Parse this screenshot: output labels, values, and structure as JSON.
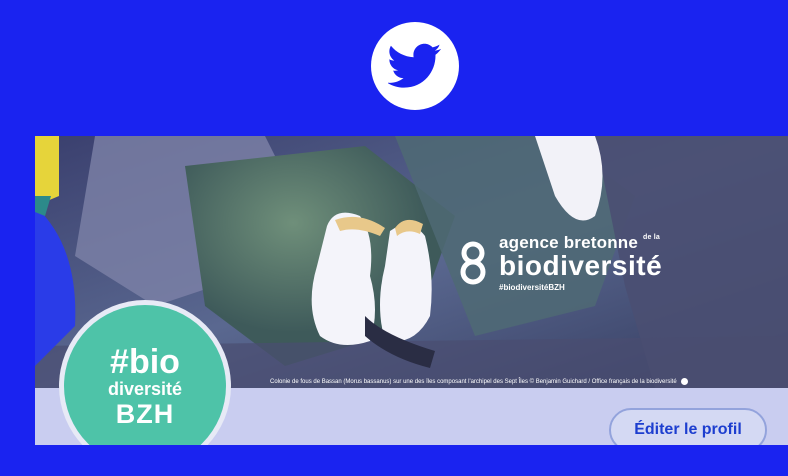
{
  "brand": {
    "icon": "twitter-bird-icon",
    "background": "#1a23f0"
  },
  "banner": {
    "logo_line1": "agence bretonne",
    "logo_line1_small": "de la",
    "logo_line2": "biodiversité",
    "logo_line3": "#biodiversitéBZH",
    "caption": "Colonie de fous de Bassan (Morus bassanus) sur une des îles composant l'archipel des Sept Îles © Benjamin Guichard / Office français de la biodiversité"
  },
  "avatar": {
    "line1": "#bio",
    "line2": "diversité",
    "line3": "BZH",
    "color": "#4ec3a8"
  },
  "actions": {
    "edit_profile_label": "Éditer le profil",
    "accent": "#1d3ecf"
  }
}
